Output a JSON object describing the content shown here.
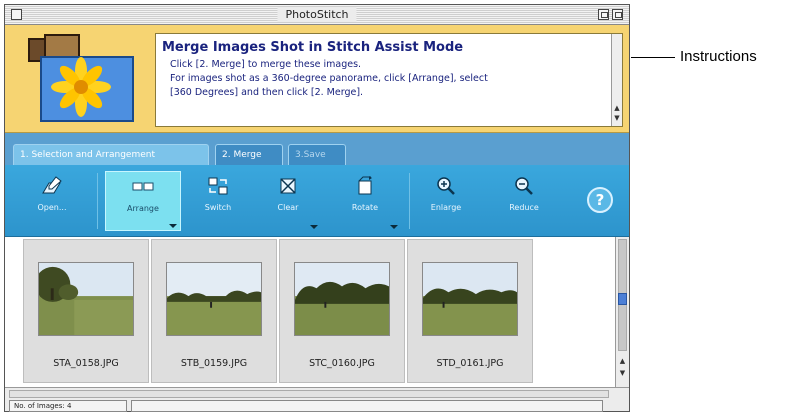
{
  "window": {
    "title": "PhotoStitch"
  },
  "instructions": {
    "heading": "Merge Images Shot in Stitch Assist Mode",
    "line1": "Click [2. Merge] to merge these images.",
    "line2": "For images shot as a 360-degree panorame, click [Arrange], select",
    "line3": "[360 Degrees] and then click [2. Merge]."
  },
  "tabs": [
    {
      "label": "1. Selection and Arrangement",
      "active": true
    },
    {
      "label": "2. Merge",
      "active": false
    },
    {
      "label": "3.Save",
      "active": false
    }
  ],
  "toolbar": {
    "open": "Open...",
    "arrange": "Arrange",
    "switch": "Switch",
    "clear": "Clear",
    "rotate": "Rotate",
    "enlarge": "Enlarge",
    "reduce": "Reduce",
    "help": "?"
  },
  "images": [
    {
      "filename": "STA_0158.JPG"
    },
    {
      "filename": "STB_0159.JPG"
    },
    {
      "filename": "STC_0160.JPG"
    },
    {
      "filename": "STD_0161.JPG"
    }
  ],
  "status": {
    "count": "No. of Images: 4"
  },
  "callout": {
    "label": "Instructions"
  },
  "colors": {
    "instruction_bg": "#f6d472",
    "toolbar_bg": "#3aa7dd",
    "text_blue": "#1a237e"
  }
}
